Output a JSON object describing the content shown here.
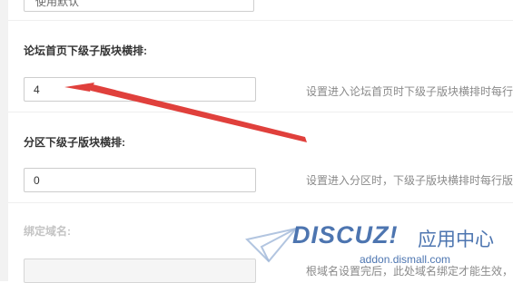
{
  "top_select": {
    "value": "使用默认",
    "chevron_icon": "chevron-down-icon"
  },
  "field_forum_home": {
    "label": "论坛首页下级子版块横排:",
    "value": "4",
    "hint": "设置进入论坛首页时下级子版块横排时每行"
  },
  "field_section": {
    "label": "分区下级子版块横排:",
    "value": "0",
    "hint": "设置进入分区时，下级子版块横排时每行版"
  },
  "field_domain": {
    "label": "绑定域名:",
    "value": "",
    "hint": "根域名设置完后，此处域名绑定才能生效，"
  },
  "annotation": {
    "color": "#e0403c",
    "icon": "red-arrow-icon"
  },
  "watermark": {
    "brand": "DISCUZ!",
    "subtitle": "应用中心",
    "url": "addon.dismall.com",
    "color": "#3a67a8"
  }
}
